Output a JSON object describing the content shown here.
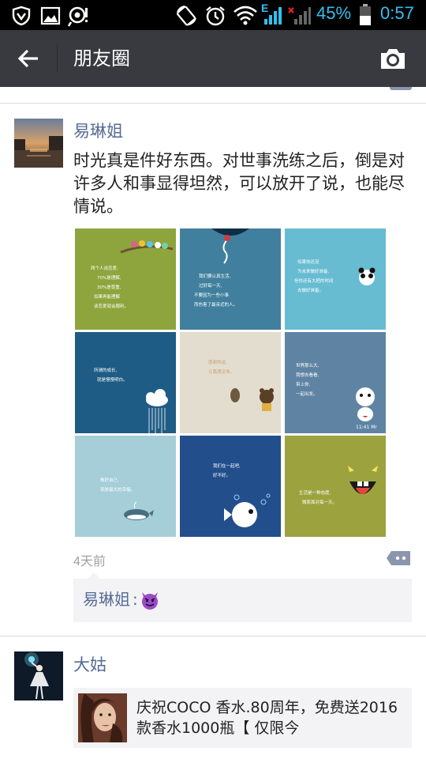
{
  "status_bar": {
    "battery": "45%",
    "time": "0:57",
    "network": "E"
  },
  "app_bar": {
    "title": "朋友圈"
  },
  "colors": {
    "app_bar": "#393a3f",
    "username": "#576b95",
    "timestamp": "#a0a0a0",
    "comment_bg": "#f3f3f5"
  },
  "icons": [
    "shield-icon",
    "gallery-icon",
    "notification-icon",
    "rotate-icon",
    "alarm-icon",
    "wifi-icon",
    "signal-icon",
    "no-signal-icon",
    "battery-icon",
    "back-arrow-icon",
    "camera-icon",
    "comment-icon",
    "devil-emoji-icon"
  ],
  "posts": [
    {
      "author": "易琳姐",
      "text": "时光真是件好东西。对世事洗练之后，倒是对许多人和事显得坦然，可以放开了说，也能尽情说。",
      "time": "4天前",
      "images": [
        {
          "lines": [
            "两个人谈恋爱,",
            "70%是理解,",
            "30%是尊重,",
            "如果再能理解",
            "谈恋爱就会顺利。"
          ]
        },
        {
          "lines": [
            "我们要认真生活,",
            "过好每一天,",
            "不要因为一些小事",
            "而伤害了最亲近的人。"
          ]
        },
        {
          "lines": [
            "如果你还没",
            "为未来做好准备,",
            "但你还有大把的时间",
            "去做好准备。"
          ]
        },
        {
          "lines": [
            "所谓的成长,",
            "就是慢慢明白。"
          ]
        },
        {
          "lines": [
            "感谢命运,",
            "让我遇见你。"
          ]
        },
        {
          "lines": [
            "世界那么大,",
            "我想去看看,",
            "带上你,",
            "一起出发。"
          ],
          "caption": "11:41 Mr"
        },
        {
          "lines": [
            "做好自己,",
            "就是最大的幸福。"
          ]
        },
        {
          "lines": [
            "我们在一起吧,",
            "好不好。"
          ]
        },
        {
          "lines": [
            "生活是一种态度,",
            "微笑面对每一天。"
          ]
        }
      ],
      "comments": [
        {
          "author": "易琳姐",
          "emoji": "devil-emoji"
        }
      ]
    },
    {
      "author": "大姑",
      "share": {
        "text": "庆祝COCO 香水.80周年，免费送2016款香水1000瓶【 仅限今"
      }
    }
  ]
}
